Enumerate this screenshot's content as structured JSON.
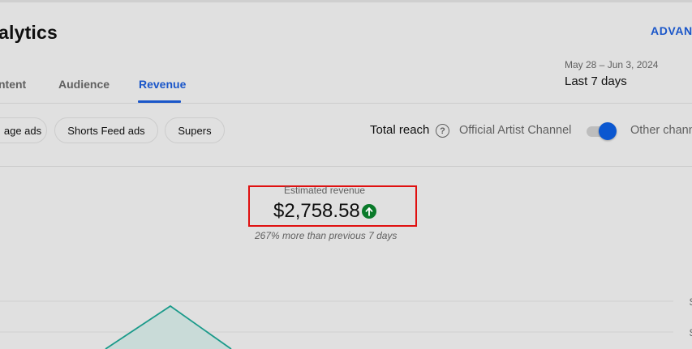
{
  "header": {
    "title": "alytics",
    "advanced_label": "ADVANC"
  },
  "tabs": [
    {
      "label": "ntent",
      "selected": false
    },
    {
      "label": "Audience",
      "selected": false
    },
    {
      "label": "Revenue",
      "selected": true
    }
  ],
  "date_picker": {
    "range": "May 28 – Jun 3, 2024",
    "period": "Last 7 days"
  },
  "filters": {
    "chips": [
      "age ads",
      "Shorts Feed ads",
      "Supers"
    ],
    "total_reach_label": "Total reach",
    "help_symbol": "?",
    "official_channel_label": "Official Artist Channel",
    "toggle_on": true,
    "other_label": "Other chann"
  },
  "metric": {
    "label": "Estimated revenue",
    "value": "$2,758.58",
    "trend": "up",
    "comparison": "267% more than previous 7 days"
  },
  "chart_data": {
    "type": "area",
    "visible_tick_labels": [
      "$",
      "$"
    ]
  },
  "colors": {
    "accent": "#1a56c9",
    "toggle": "#0b57d0",
    "trend_up": "#0a7a2a",
    "highlight_box": "#e01010",
    "chart_line": "#1a9a8a",
    "chart_fill": "#c9dbd8"
  }
}
